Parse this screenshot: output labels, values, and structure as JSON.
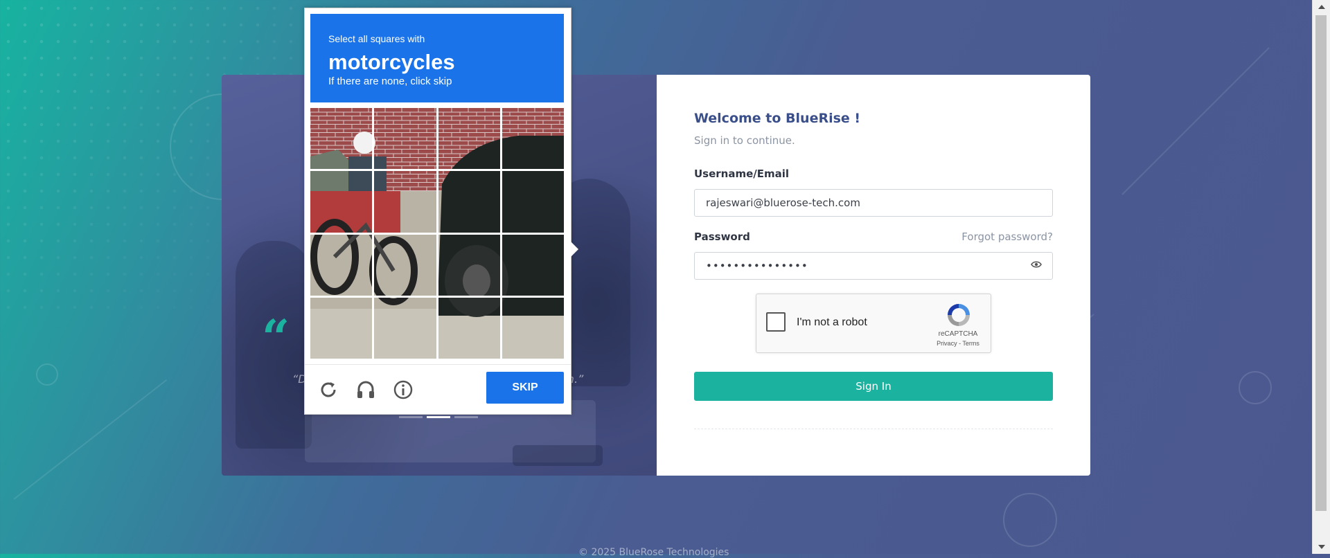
{
  "background": {
    "gradient_start": "#17b3a0",
    "gradient_end": "#4b5890"
  },
  "login": {
    "title": "Welcome to BlueRise !",
    "subtitle": "Sign in to continue.",
    "username_label": "Username/Email",
    "username_value": "rajeswari@bluerose-tech.com",
    "password_label": "Password",
    "password_value": "•••••••••••••••",
    "forgot_password": "Forgot password?",
    "signin_label": "Sign In",
    "accent_color": "#1bb39f"
  },
  "recaptcha": {
    "checkbox_label": "I'm not a robot",
    "brand": "reCAPTCHA",
    "privacy": "Privacy",
    "separator": " - ",
    "terms": "Terms"
  },
  "challenge": {
    "line1": "Select all squares with",
    "keyword": "motorcycles",
    "line3": "If there are none, click skip",
    "skip_label": "SKIP",
    "header_color": "#1a73e8",
    "grid_rows": 4,
    "grid_cols": 4,
    "icons": [
      "reload-icon",
      "audio-icon",
      "info-icon"
    ]
  },
  "left_panel": {
    "quote_mark": "“",
    "quote_start": "“D",
    "quote_end": "ch.”",
    "carousel_active_index": 1,
    "carousel_count": 3
  },
  "footer": {
    "copyright": "© 2025 BlueRose Technologies"
  }
}
